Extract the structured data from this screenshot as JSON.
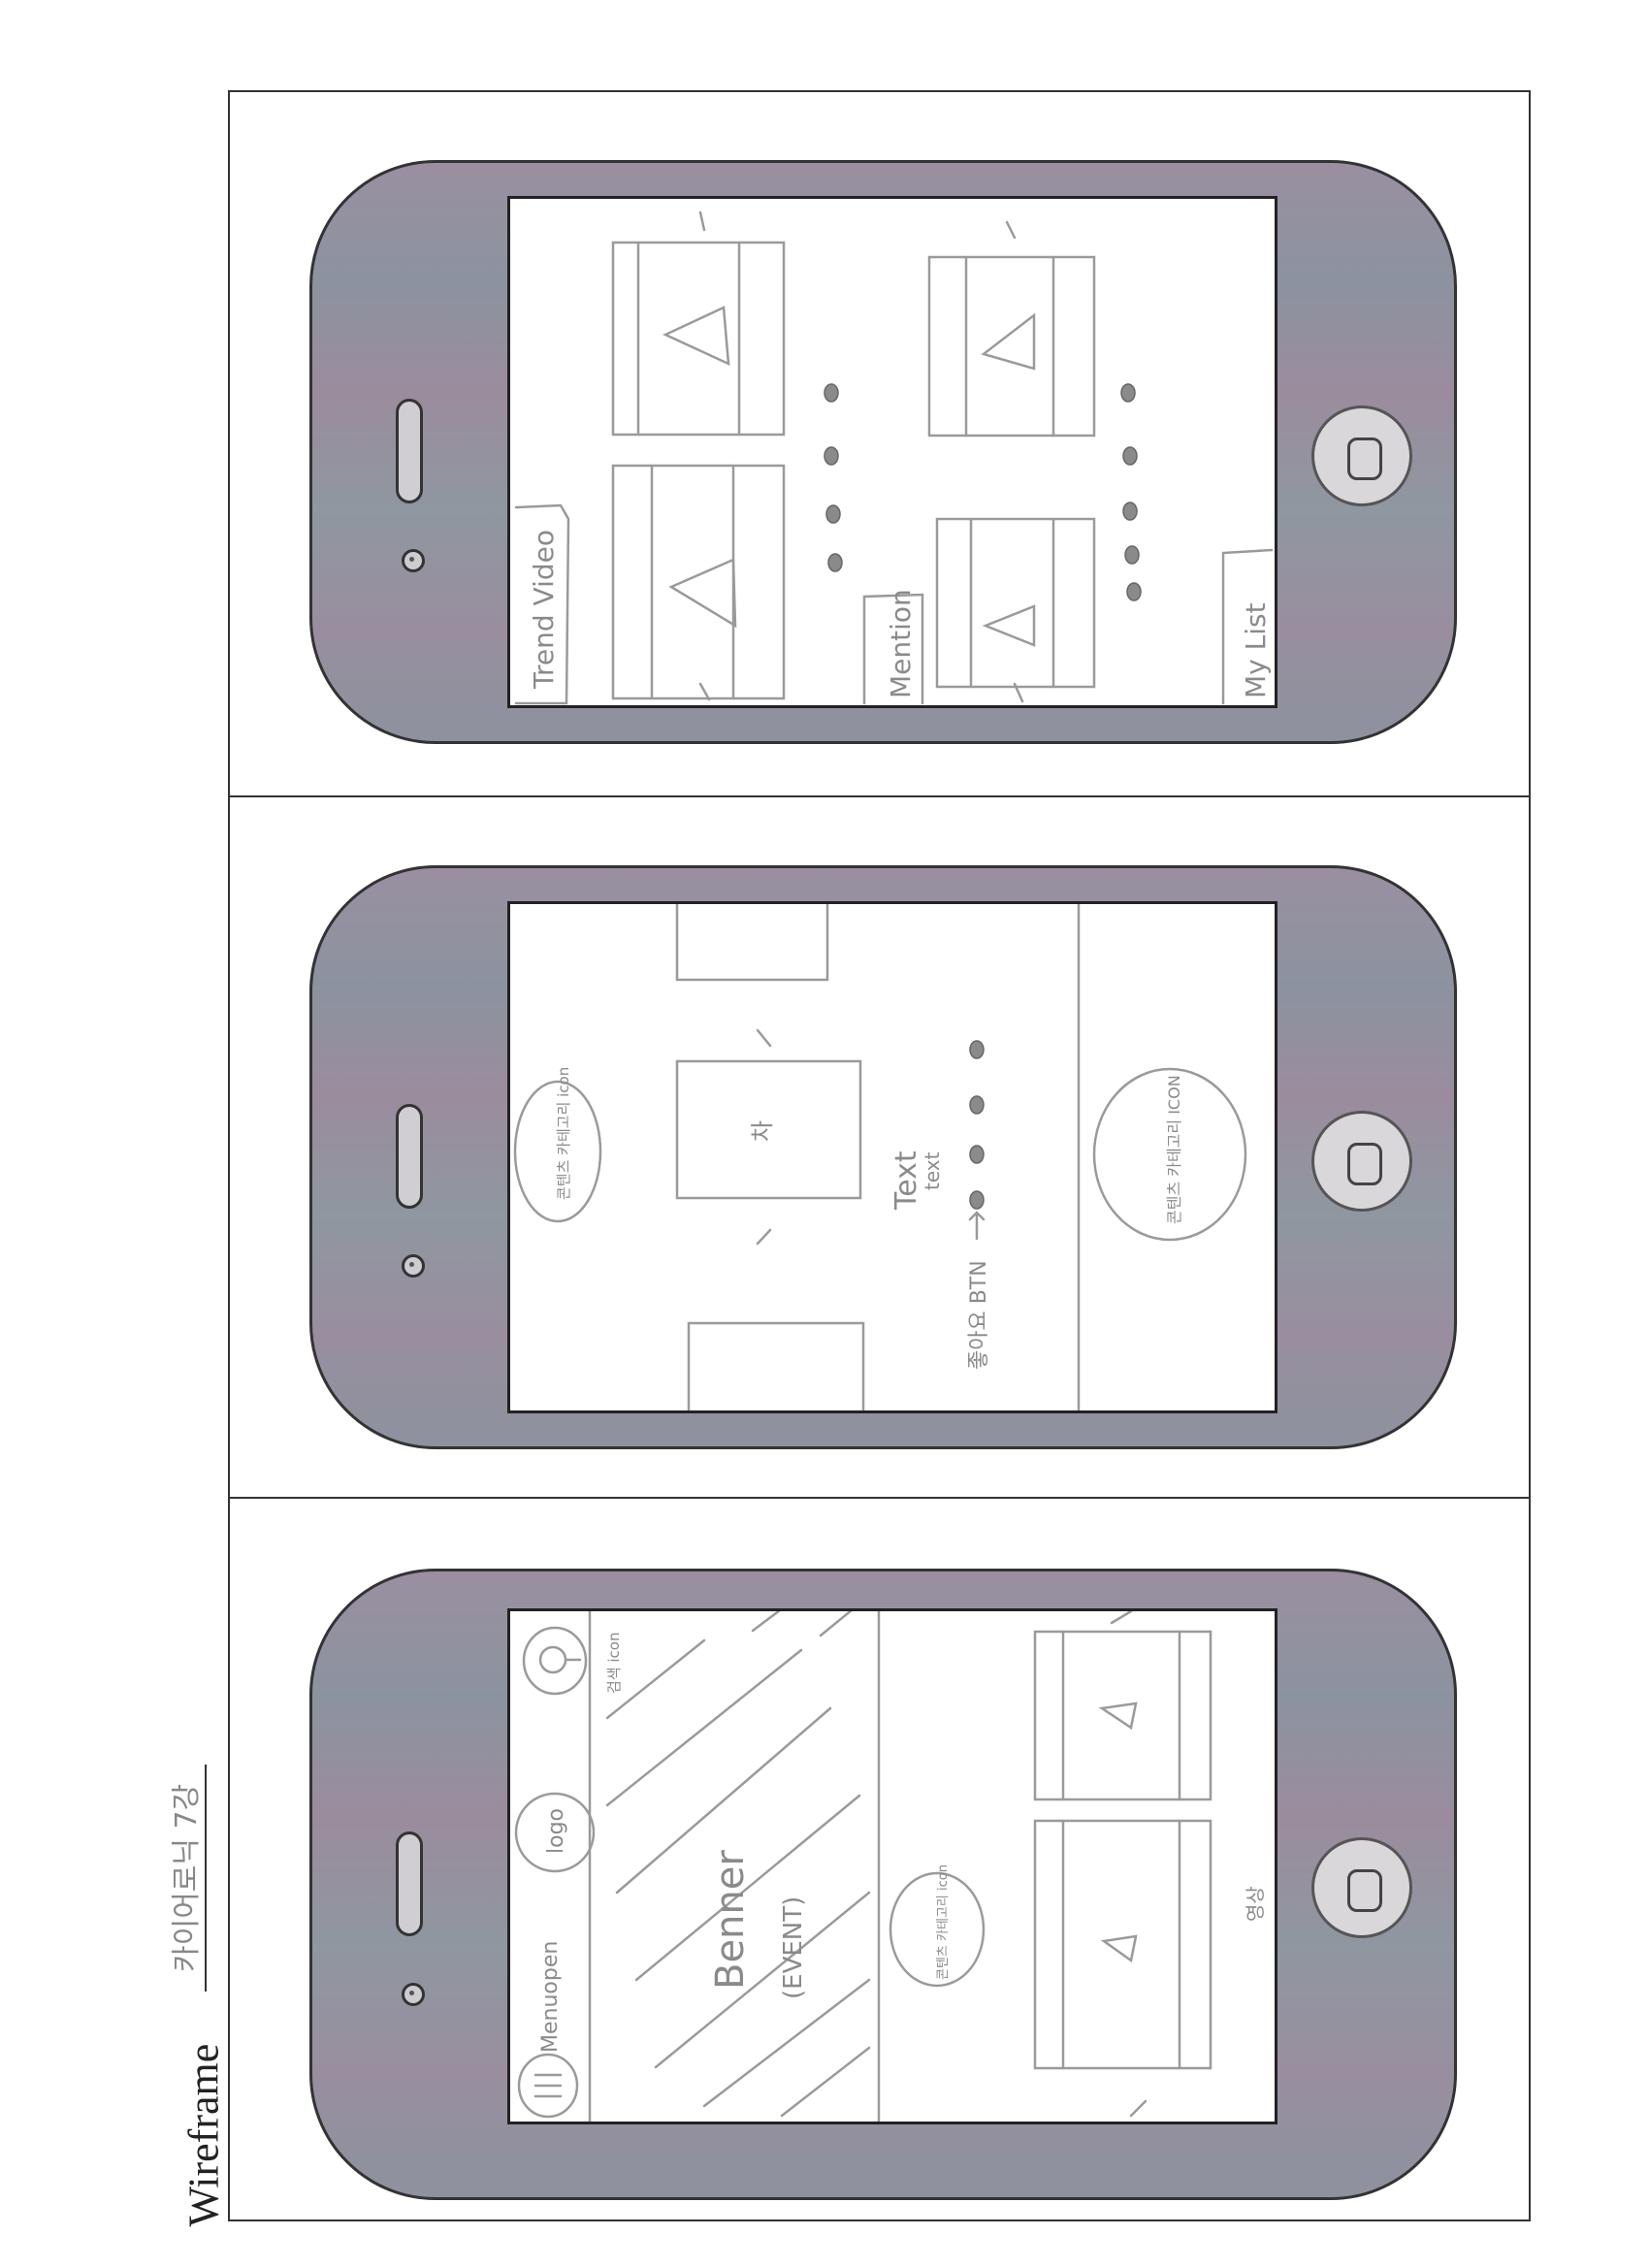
{
  "page": {
    "title": "Wireframe",
    "subtitle": "카이어로닉 7강"
  },
  "screen_home": {
    "menu_label": "Menuopen",
    "menu_icon": "hamburger-icon",
    "logo_label": "logo",
    "search_label": "검색 icon",
    "banner_label": "Benner",
    "banner_sub": "(EVENT)",
    "category_label": "콘텐츠 카테고리 icon",
    "video_caption": "영상"
  },
  "screen_detail": {
    "category_label_top": "콘텐츠 카테고리 icon",
    "card_label": "차",
    "text_title": "Text",
    "text_sub": "text",
    "like_button": "좋아요 BTN",
    "category_label_bottom": "콘텐츠 카테고리 ICON"
  },
  "screen_list": {
    "trend_video": "Trend Video",
    "mention": "Mention",
    "my_list": "My List"
  },
  "colors": {
    "sketch": "#9a9a9a",
    "phone_body": "#958fa0",
    "frame": "#333333"
  }
}
